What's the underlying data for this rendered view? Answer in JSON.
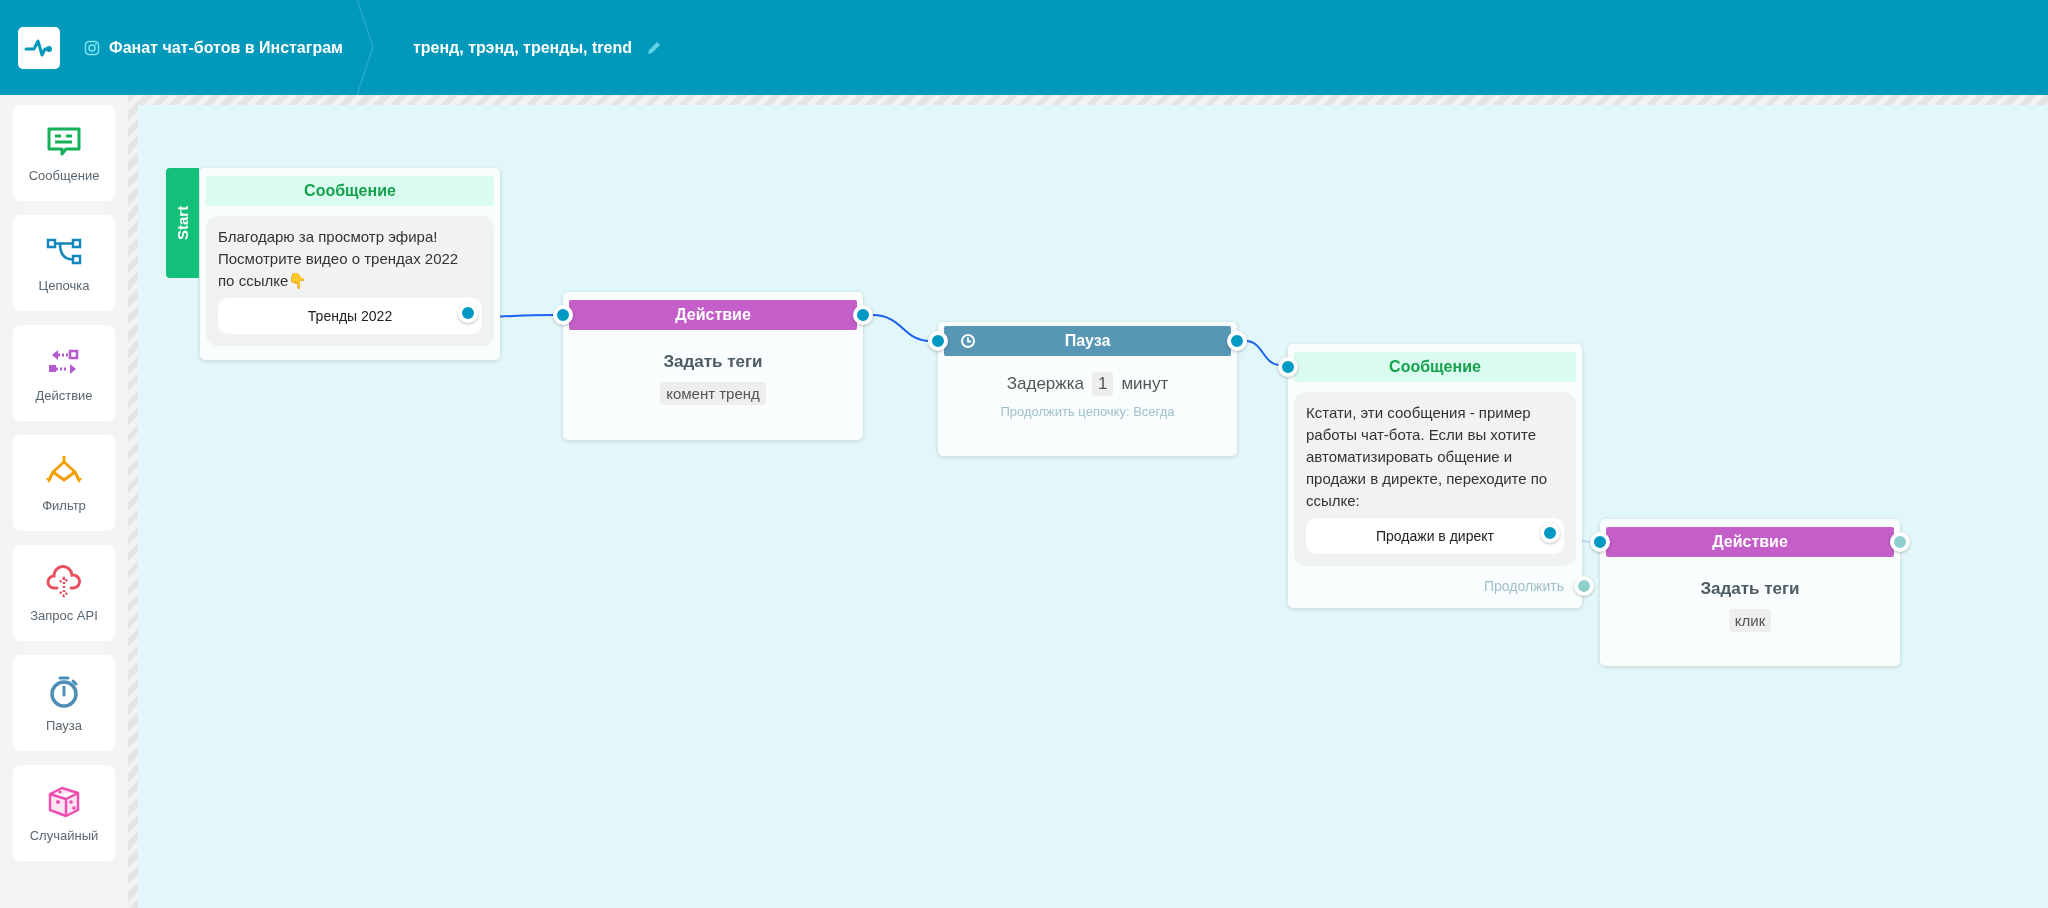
{
  "header": {
    "account": "Фанат чат-ботов в Инстаграм",
    "title": "тренд, трэнд, тренды, trend"
  },
  "palette": [
    {
      "kind": "message",
      "label": "Сообщение"
    },
    {
      "kind": "chain",
      "label": "Цепочка"
    },
    {
      "kind": "action",
      "label": "Действие"
    },
    {
      "kind": "filter",
      "label": "Фильтр"
    },
    {
      "kind": "api",
      "label": "Запрос API"
    },
    {
      "kind": "pause",
      "label": "Пауза"
    },
    {
      "kind": "random",
      "label": "Случайный"
    }
  ],
  "nodes": [
    {
      "kind": "message",
      "start_label": "Start",
      "title": "Сообщение",
      "text": "Благодарю за просмотр эфира! Посмотрите видео о трендах 2022 по ссылке👇",
      "buttons": [
        {
          "label": "Тренды 2022",
          "connected": true
        }
      ]
    },
    {
      "kind": "action",
      "title": "Действие",
      "subtitle": "Задать теги",
      "tag": "комент тренд",
      "out_connected": true
    },
    {
      "kind": "pause",
      "title": "Пауза",
      "delay_label": "Задержка",
      "delay_value": "1",
      "unit": "минут",
      "note": "Продолжить цепочку: Всегда",
      "out_connected": true
    },
    {
      "kind": "message",
      "title": "Сообщение",
      "text": "Кстати, эти сообщения - пример работы чат-бота. Если вы хотите автоматизировать общение и продажи в директе, переходите по ссылке:",
      "buttons": [
        {
          "label": "Продажи в директ",
          "connected": true
        }
      ],
      "continue_label": "Продолжить",
      "continue_connected": false
    },
    {
      "kind": "action",
      "title": "Действие",
      "subtitle": "Задать теги",
      "tag": "клик",
      "out_connected": false
    }
  ]
}
